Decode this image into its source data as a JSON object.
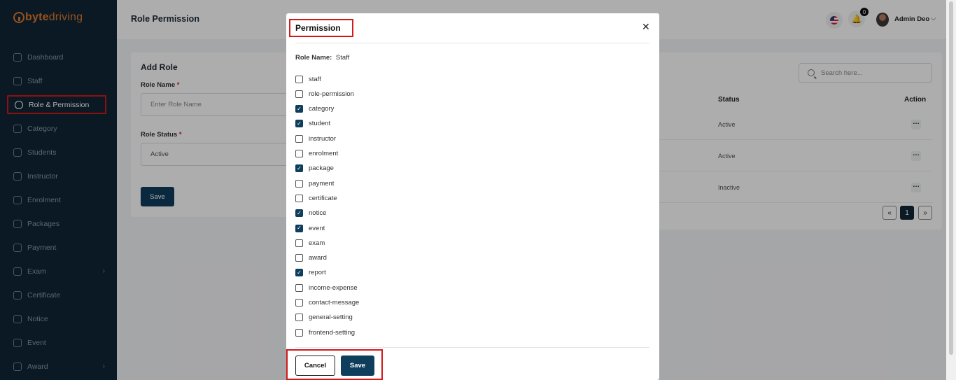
{
  "brand": {
    "prefix": "byte",
    "suffix": "driving"
  },
  "sidebar": {
    "items": [
      {
        "label": "Dashboard",
        "icon": "grid-icon"
      },
      {
        "label": "Staff",
        "icon": "user-icon"
      },
      {
        "label": "Role & Permission",
        "icon": "shield-icon",
        "active": true
      },
      {
        "label": "Category",
        "icon": "folder-icon"
      },
      {
        "label": "Students",
        "icon": "users-icon"
      },
      {
        "label": "Instructor",
        "icon": "user-icon"
      },
      {
        "label": "Enrolment",
        "icon": "enrol-icon"
      },
      {
        "label": "Packages",
        "icon": "layers-icon"
      },
      {
        "label": "Payment",
        "icon": "dollar-icon"
      },
      {
        "label": "Exam",
        "icon": "exam-icon",
        "has_children": true
      },
      {
        "label": "Certificate",
        "icon": "certificate-icon"
      },
      {
        "label": "Notice",
        "icon": "notice-icon"
      },
      {
        "label": "Event",
        "icon": "calendar-icon"
      },
      {
        "label": "Award",
        "icon": "award-icon",
        "has_children": true
      }
    ]
  },
  "header": {
    "title": "Role Permission",
    "notification_count": "0",
    "user_name": "Admin Deo"
  },
  "add_role": {
    "title": "Add Role",
    "role_name_label": "Role Name",
    "role_name_placeholder": "Enter Role Name",
    "role_status_label": "Role Status",
    "role_status_value": "Active",
    "required_mark": "*",
    "save_label": "Save"
  },
  "roles_table": {
    "search_placeholder": "Search here...",
    "columns": {
      "status": "Status",
      "action": "Action"
    },
    "rows": [
      {
        "status": "Active"
      },
      {
        "status": "Active"
      },
      {
        "status": "Inactive"
      }
    ],
    "pagination": {
      "prev": "«",
      "current": "1",
      "next": "»"
    }
  },
  "modal": {
    "title": "Permission",
    "role_name_label": "Role Name:",
    "role_name_value": "Staff",
    "permissions": [
      {
        "label": "staff",
        "checked": false
      },
      {
        "label": "role-permission",
        "checked": false
      },
      {
        "label": "category",
        "checked": true
      },
      {
        "label": "student",
        "checked": true
      },
      {
        "label": "instructor",
        "checked": false
      },
      {
        "label": "enrolment",
        "checked": false
      },
      {
        "label": "package",
        "checked": true
      },
      {
        "label": "payment",
        "checked": false
      },
      {
        "label": "certificate",
        "checked": false
      },
      {
        "label": "notice",
        "checked": true
      },
      {
        "label": "event",
        "checked": true
      },
      {
        "label": "exam",
        "checked": false
      },
      {
        "label": "award",
        "checked": false
      },
      {
        "label": "report",
        "checked": true
      },
      {
        "label": "income-expense",
        "checked": false
      },
      {
        "label": "contact-message",
        "checked": false
      },
      {
        "label": "general-setting",
        "checked": false
      },
      {
        "label": "frontend-setting",
        "checked": false
      }
    ],
    "cancel_label": "Cancel",
    "save_label": "Save"
  },
  "colors": {
    "sidebar_bg": "#0f2534",
    "primary": "#0f3d5c",
    "highlight_border": "#d11a1a",
    "brand_orange": "#e07a2c"
  }
}
